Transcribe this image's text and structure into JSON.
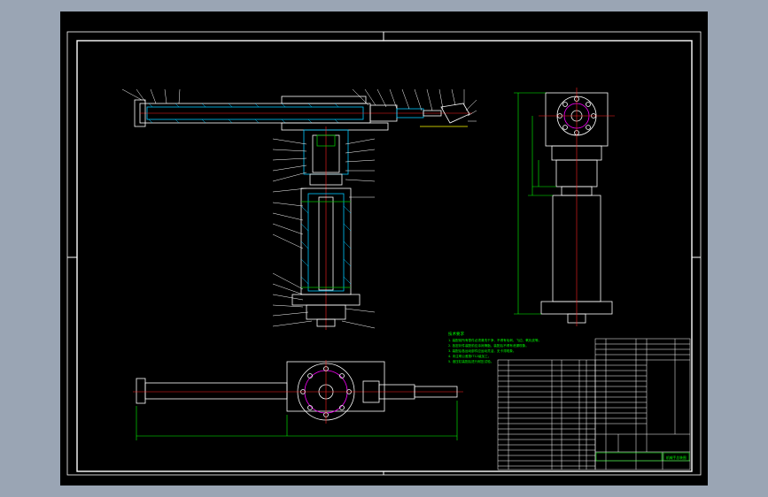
{
  "drawing": {
    "background_color": "#000000",
    "frame_color": "#ffffff",
    "line_colors": {
      "outline": "#ffffff",
      "section_hatch": "#00c8ff",
      "centerline": "#ff2020",
      "dimension": "#00ff00",
      "hidden": "#ffff00",
      "highlight": "#ff00ff",
      "green_part": "#00c000"
    },
    "technical_requirements": {
      "heading": "技术要求",
      "lines": [
        "1. 装配前所有零件必须清洗干净，不得有毛刺、飞边、氧化皮等。",
        "2. 各密封件装配前应涂润滑脂，装配后不得有泄漏现象。",
        "3. 装配后各运动部件应运动灵活，无卡滞现象。",
        "4. 未注明公差按IT12级加工。",
        "5. 液压缸装配后进行耐压试验。"
      ]
    },
    "title_block": {
      "bottom_right_label": "机械手总装图"
    },
    "icons": [
      "flange-bolt-circle-icon",
      "cylinder-icon"
    ]
  }
}
